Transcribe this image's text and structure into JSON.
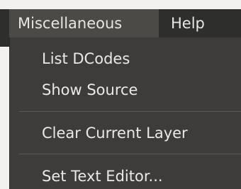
{
  "menubar": {
    "items": [
      {
        "label": "Miscellaneous",
        "active": true
      },
      {
        "label": "Help",
        "active": false
      }
    ]
  },
  "dropdown": {
    "items": [
      {
        "label": "List DCodes"
      },
      {
        "label": "Show Source"
      },
      {
        "label": "Clear Current Layer"
      },
      {
        "label": "Set Text Editor..."
      }
    ]
  },
  "colors": {
    "menubar_bg": "#2e2e2c",
    "active_item_bg": "#4b4a47",
    "dropdown_bg": "#3d3c3a",
    "text": "#e9e9e9"
  }
}
